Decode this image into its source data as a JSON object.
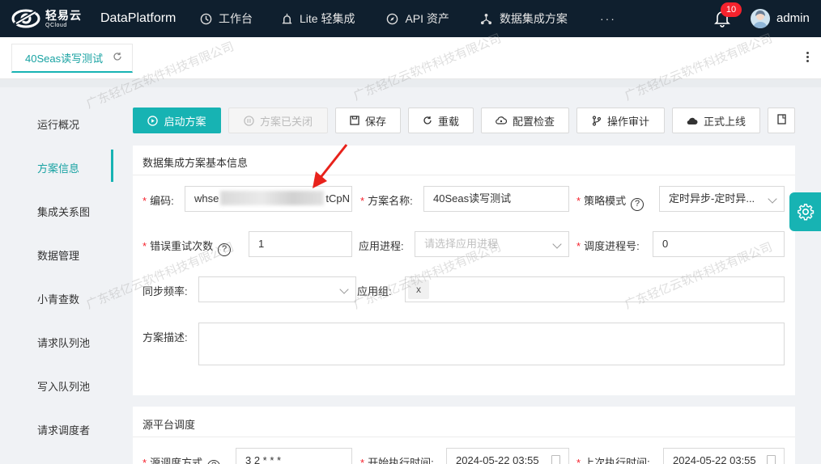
{
  "topbar": {
    "logo_cn": "轻易云",
    "logo_en": "QCloud",
    "brand": "DataPlatform",
    "nav": [
      {
        "label": "工作台",
        "icon": "clock-icon"
      },
      {
        "label": "Lite 轻集成",
        "icon": "alarm-light-icon"
      },
      {
        "label": "API 资产",
        "icon": "compass-icon"
      },
      {
        "label": "数据集成方案",
        "icon": "network-icon"
      }
    ],
    "more": "···",
    "notifications": "10",
    "user": "admin"
  },
  "tabs": {
    "active_label": "40Seas读写测试"
  },
  "sidebar": {
    "items": [
      "运行概况",
      "方案信息",
      "集成关系图",
      "数据管理",
      "小青查数",
      "请求队列池",
      "写入队列池",
      "请求调度者"
    ],
    "active_index": 1
  },
  "toolbar": {
    "start": "启动方案",
    "closed": "方案已关闭",
    "save": "保存",
    "reload": "重载",
    "config_check": "配置检查",
    "audit": "操作审计",
    "go_live": "正式上线"
  },
  "basic_panel": {
    "title": "数据集成方案基本信息",
    "code_label": "编码:",
    "code_value_start": "whse",
    "code_value_end": "tCpN",
    "name_label": "方案名称:",
    "name_value": "40Seas读写测试",
    "strategy_label": "策略模式",
    "strategy_value": "定时异步-定时异...",
    "retry_label": "错误重试次数",
    "retry_value": "1",
    "app_process_label": "应用进程:",
    "app_process_placeholder": "请选择应用进程",
    "sched_process_label": "调度进程号:",
    "sched_process_value": "0",
    "sync_freq_label": "同步频率:",
    "app_group_label": "应用组:",
    "tag_close": "x",
    "desc_label": "方案描述:"
  },
  "source_panel": {
    "title": "源平台调度",
    "mode_label": "源调度方式",
    "mode_value": "3 2 * * *",
    "start_label": "开始执行时间:",
    "start_value": "2024-05-22 03:55",
    "last_label": "上次执行时间:",
    "last_value": "2024-05-22 03:55"
  },
  "watermark": "广东轻亿云软件科技有限公司",
  "colors": {
    "accent": "#17b3b3",
    "topbar": "#0f1f2e",
    "badge": "#f5222d",
    "arrow": "#e8221b"
  }
}
